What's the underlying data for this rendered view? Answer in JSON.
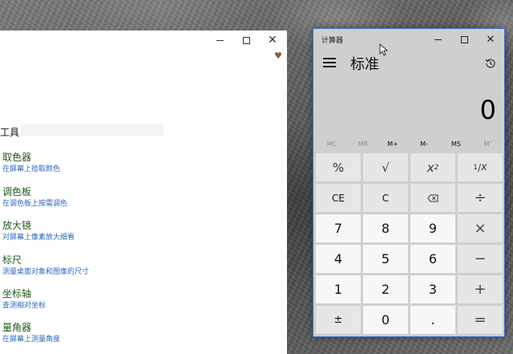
{
  "desktop": {
    "accent": "#3a6fc9"
  },
  "tool_window": {
    "heading": "工具",
    "items": [
      {
        "title": "取色器",
        "desc": "在屏幕上拾取颜色"
      },
      {
        "title": "调色板",
        "desc": "在调色板上按需调色"
      },
      {
        "title": "放大镜",
        "desc": "对屏幕上像素放大细看"
      },
      {
        "title": "标尺",
        "desc": "测量桌面对象和图像的尺寸"
      },
      {
        "title": "坐标轴",
        "desc": "查测相对坐标"
      },
      {
        "title": "量角器",
        "desc": "在屏幕上测量角度"
      }
    ],
    "controls": {
      "minimize": "minimize",
      "maximize": "maximize",
      "close": "✕"
    }
  },
  "calculator": {
    "window_title": "计算器",
    "mode": "标准",
    "display": "0",
    "controls": {
      "close": "✕"
    },
    "memory": [
      {
        "label": "MC",
        "enabled": false
      },
      {
        "label": "MR",
        "enabled": false
      },
      {
        "label": "M+",
        "enabled": true
      },
      {
        "label": "M-",
        "enabled": true
      },
      {
        "label": "MS",
        "enabled": true
      },
      {
        "label": "M˅",
        "enabled": false
      }
    ],
    "keys": {
      "percent": "%",
      "sqrt": "√",
      "square_base": "x",
      "square_exp": "2",
      "reciprocal_num": "1",
      "reciprocal_den": "x",
      "ce": "CE",
      "c": "C",
      "backspace": "⌫",
      "divide": "÷",
      "seven": "7",
      "eight": "8",
      "nine": "9",
      "multiply": "×",
      "four": "4",
      "five": "5",
      "six": "6",
      "minus": "−",
      "one": "1",
      "two": "2",
      "three": "3",
      "plus": "+",
      "negate": "±",
      "zero": "0",
      "decimal": ".",
      "equals": "="
    }
  }
}
